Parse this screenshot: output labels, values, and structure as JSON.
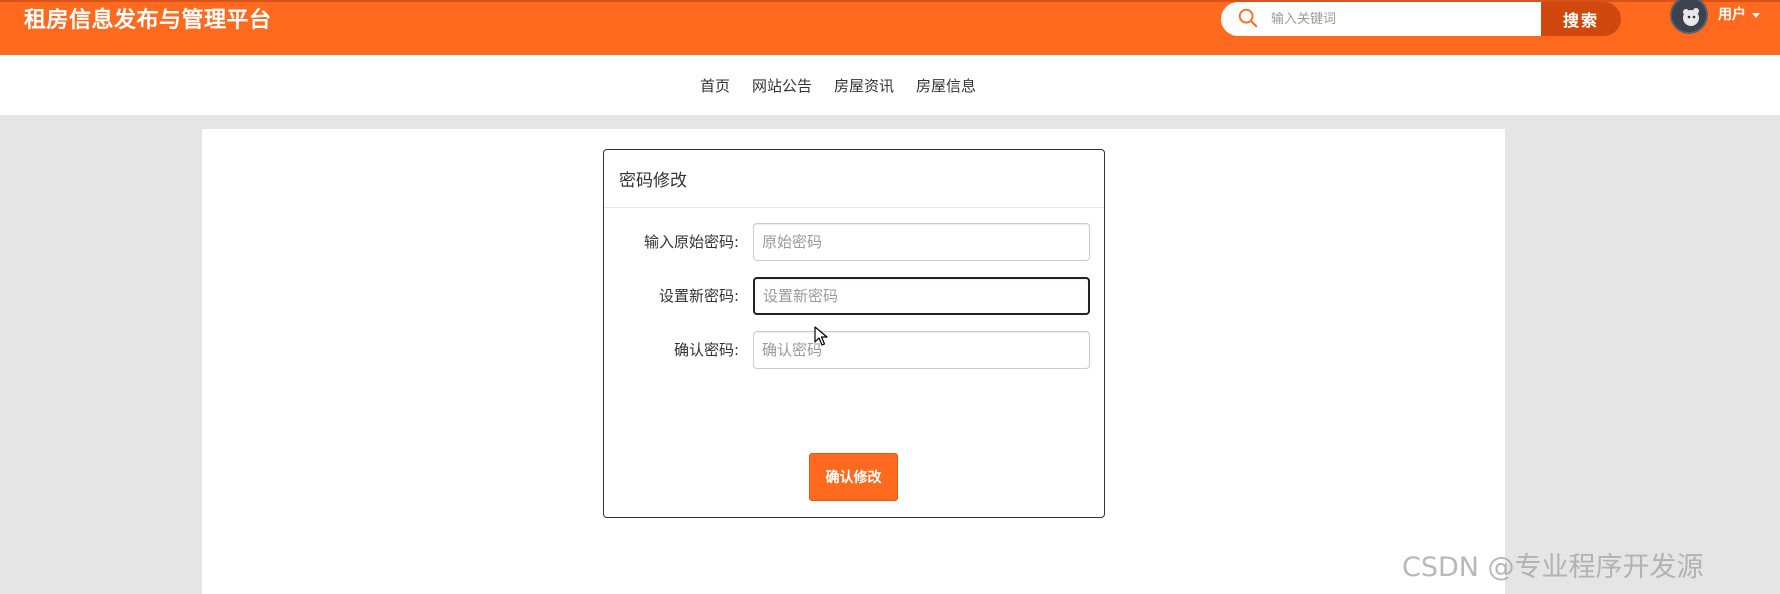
{
  "header": {
    "site_title": "租房信息发布与管理平台",
    "search_placeholder": "输入关键词",
    "search_button": "搜索",
    "user_label": "用户"
  },
  "nav": {
    "items": [
      "首页",
      "网站公告",
      "房屋资讯",
      "房屋信息"
    ]
  },
  "password_form": {
    "title": "密码修改",
    "fields": [
      {
        "label": "输入原始密码:",
        "placeholder": "原始密码",
        "value": ""
      },
      {
        "label": "设置新密码:",
        "placeholder": "设置新密码",
        "value": ""
      },
      {
        "label": "确认密码:",
        "placeholder": "确认密码",
        "value": ""
      }
    ],
    "submit_label": "确认修改"
  },
  "watermark": "CSDN @专业程序开发源",
  "colors": {
    "brand_orange": "#ff6a1f",
    "search_button": "#d0480e"
  }
}
